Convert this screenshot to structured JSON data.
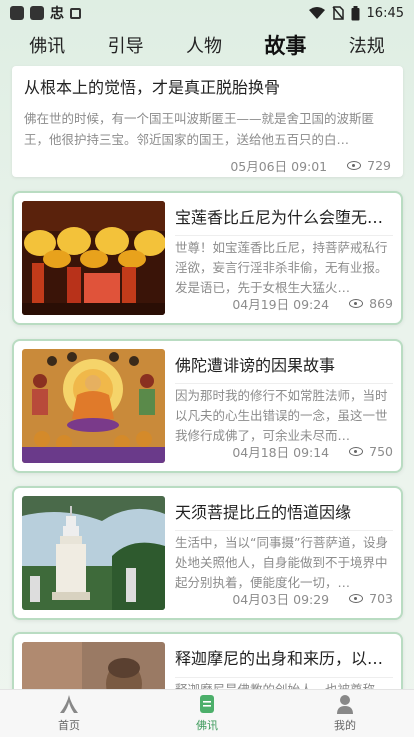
{
  "status": {
    "time": "16:45",
    "app_glyph": "忠"
  },
  "tabs": [
    {
      "label": "佛讯",
      "active": false
    },
    {
      "label": "引导",
      "active": false
    },
    {
      "label": "人物",
      "active": false
    },
    {
      "label": "故事",
      "active": true
    },
    {
      "label": "法规",
      "active": false
    }
  ],
  "articles": [
    {
      "title": "从根本上的觉悟，才是真正脱胎换骨",
      "excerpt": "佛在世的时候，有一个国王叫波斯匿王——就是舍卫国的波斯匿王，他很护持三宝。邻近国家的国王，送给他五百只的白…",
      "date": "05月06日 09:01",
      "views": "729"
    },
    {
      "title": "宝莲香比丘尼为什么会堕无间地狱",
      "excerpt": "世尊！如宝莲香比丘尼，持菩萨戒私行淫欲，妄言行淫非杀非偷，无有业报。发是语已，先于女根生大猛火…",
      "date": "04月19日 09:24",
      "views": "869",
      "image": "lotus-lanterns"
    },
    {
      "title": "佛陀遭诽谤的因果故事",
      "excerpt": "因为那时我的修行不如常胜法师，当时以凡夫的心生出错误的一念，虽这一世我修行成佛了，可余业未尽而…",
      "date": "04月18日 09:14",
      "views": "750",
      "image": "buddha-painting"
    },
    {
      "title": "天须菩提比丘的悟道因缘",
      "excerpt": "生活中，当以“同事摄”行菩萨道，设身处地关照他人，自身能做到不于境界中起分别执着，便能度化一切，…",
      "date": "04月03日 09:29",
      "views": "703",
      "image": "pagoda"
    },
    {
      "title": "释迦摩尼的出身和来历，以及成佛的故事",
      "excerpt": "释迦摩尼是佛教的创始人，也被尊称为…",
      "date": "",
      "views": "",
      "image": "buddha-statue"
    }
  ],
  "bottom_nav": [
    {
      "label": "首页",
      "icon": "home-icon",
      "active": false
    },
    {
      "label": "佛讯",
      "icon": "news-icon",
      "active": true
    },
    {
      "label": "我的",
      "icon": "person-icon",
      "active": false
    }
  ],
  "colors": {
    "accent": "#3c9a5a",
    "card_border": "#b9dcc2"
  }
}
